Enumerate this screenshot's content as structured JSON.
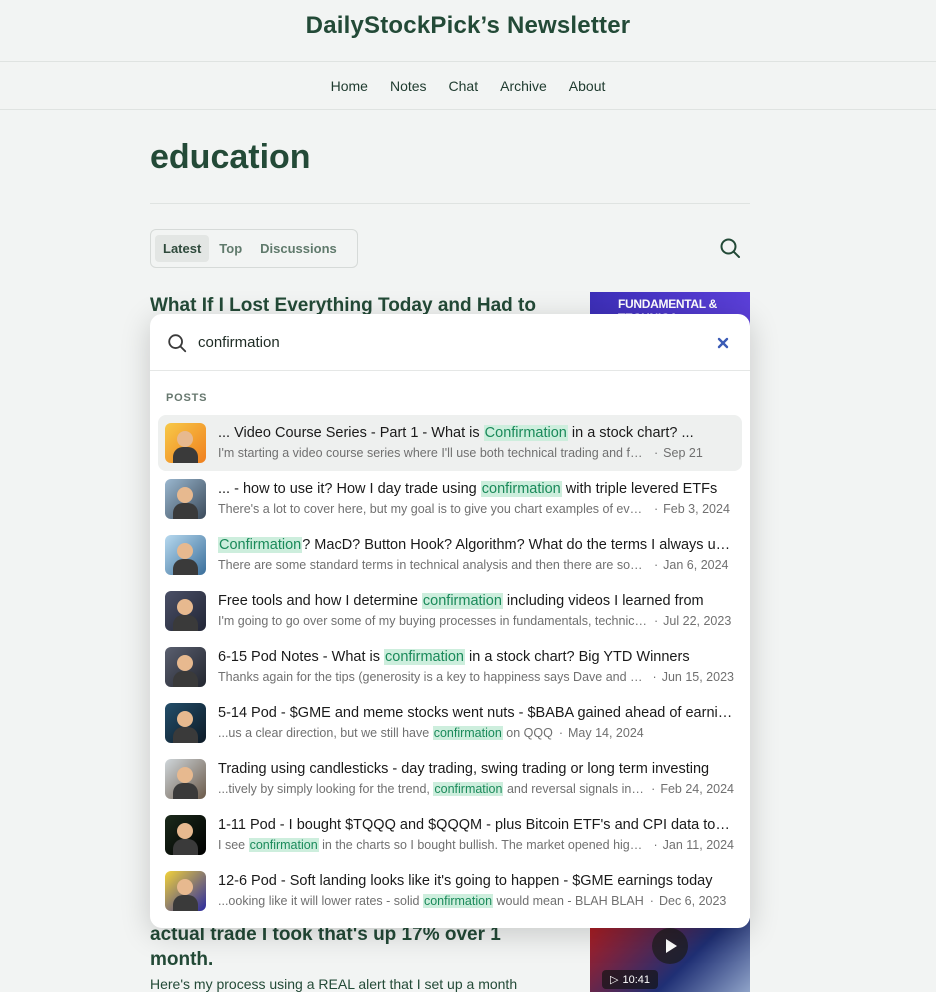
{
  "site": {
    "title": "DailyStockPick’s Newsletter"
  },
  "nav": [
    "Home",
    "Notes",
    "Chat",
    "Archive",
    "About"
  ],
  "page": {
    "title": "education"
  },
  "tabs": [
    {
      "label": "Latest",
      "active": true
    },
    {
      "label": "Top",
      "active": false
    },
    {
      "label": "Discussions",
      "active": false
    }
  ],
  "background": {
    "post1_title": "What If I Lost Everything Today and Had to",
    "thumb_top_text": "FUNDAMENTAL & TECHNICA",
    "post2_title": "actual trade I took that's up 17% over 1 month.",
    "post2_subtitle": "Here's my process using a REAL alert that I set up a month",
    "video_duration": "10:41"
  },
  "search": {
    "query": "confirmation",
    "section_label": "POSTS",
    "results": [
      {
        "before": "... Video Course Series - Part 1 - What is ",
        "hl": "Confirmation",
        "after": " in a stock chart? ...",
        "snip_before": "I'm starting a video course series where I'll use both technical trading and fundamentals",
        "snip_hl": "",
        "snip_after": "",
        "date": "Sep 21"
      },
      {
        "before": "... - how to use it? How I day trade using ",
        "hl": "confirmation",
        "after": " with triple levered ETFs",
        "snip_before": "There's a lot to cover here, but my goal is to give you chart examples of everything",
        "snip_hl": "",
        "snip_after": "",
        "date": "Feb 3, 2024"
      },
      {
        "before": "",
        "hl": "Confirmation",
        "after": "? MacD? Button Hook? Algorithm? What do the terms I always use mean?",
        "snip_before": "There are some standard terms in technical analysis and then there are some of mine",
        "snip_hl": "",
        "snip_after": "",
        "date": "Jan 6, 2024"
      },
      {
        "before": "Free tools and how I determine ",
        "hl": "confirmation",
        "after": " including videos I learned from",
        "snip_before": "I'm going to go over some of my buying processes in fundamentals, technicals and more",
        "snip_hl": "",
        "snip_after": "",
        "date": "Jul 22, 2023"
      },
      {
        "before": "6-15 Pod Notes - What is ",
        "hl": "confirmation",
        "after": " in a stock chart? Big YTD Winners",
        "snip_before": "Thanks again for the tips (generosity is a key to happiness says Dave and others)",
        "snip_hl": "",
        "snip_after": "",
        "date": "Jun 15, 2023"
      },
      {
        "before": "5-14 Pod - $GME and meme stocks went nuts - $BABA gained ahead of earnings",
        "hl": "",
        "after": "",
        "snip_before": "...us a clear direction, but we still have ",
        "snip_hl": "confirmation",
        "snip_after": " on QQQ",
        "date": "May 14, 2024"
      },
      {
        "before": "Trading using candlesticks - day trading, swing trading or long term investing",
        "hl": "",
        "after": "",
        "snip_before": "...tively by simply looking for the trend, ",
        "snip_hl": "confirmation",
        "snip_after": " and reversal signals in the candles",
        "date": "Feb 24, 2024"
      },
      {
        "before": "1-11 Pod - I bought $TQQQ and $QQQM - plus Bitcoin ETF's and CPI data today",
        "hl": "",
        "after": "",
        "snip_before": "I see ",
        "snip_hl": "confirmation",
        "snip_after": " in the charts so I bought bullish. The market opened higher",
        "date": "Jan 11, 2024"
      },
      {
        "before": "12-6 Pod - Soft landing looks like it's going to happen - $GME earnings today",
        "hl": "",
        "after": "",
        "snip_before": "...ooking like it will lower rates - solid ",
        "snip_hl": "confirmation",
        "snip_after": " would mean - BLAH BLAH",
        "date": "Dec 6, 2023"
      }
    ]
  },
  "colors": {
    "accent": "#234a37",
    "highlight_bg": "#cdeedd",
    "highlight_text": "#1a8a5a"
  },
  "icons": {
    "search": "search-icon",
    "clear": "close-icon",
    "play": "play-icon",
    "video": "video-camera-icon"
  }
}
